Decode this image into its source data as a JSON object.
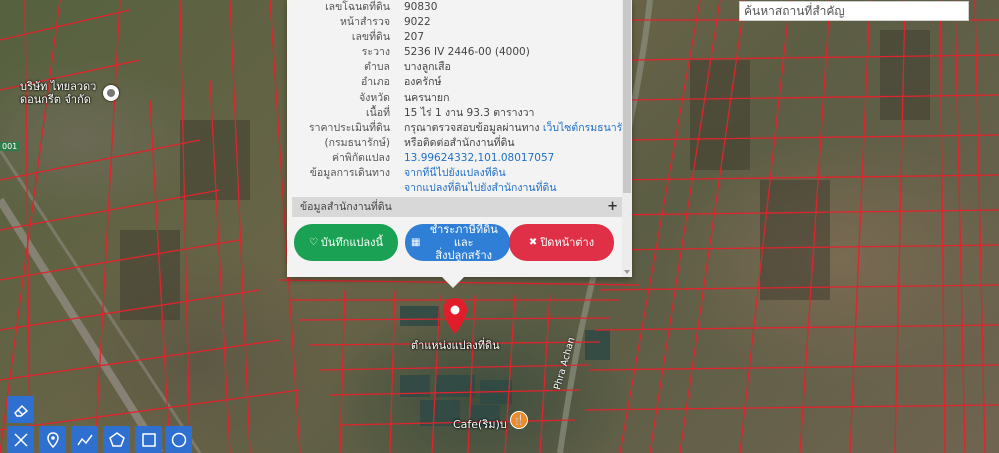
{
  "search": {
    "placeholder": "ค้นหาสถานที่สำคัญ"
  },
  "parcel": {
    "rows": [
      {
        "label": "เลขโฉนดที่ดิน",
        "value": "90830"
      },
      {
        "label": "หน้าสำรวจ",
        "value": "9022"
      },
      {
        "label": "เลขที่ดิน",
        "value": "207"
      },
      {
        "label": "ระวาง",
        "value": "5236 IV 2446-00 (4000)"
      },
      {
        "label": "ตำบล",
        "value": "บางลูกเสือ"
      },
      {
        "label": "อำเภอ",
        "value": "องครักษ์"
      },
      {
        "label": "จังหวัด",
        "value": "นครนายก"
      },
      {
        "label": "เนื้อที่",
        "value": "15 ไร่ 1 งาน 93.3 ตารางวา"
      }
    ],
    "price_label_1": "ราคาประเมินที่ดิน",
    "price_label_2": "(กรมธนารักษ์)",
    "price_text": "กรุณาตรวจสอบข้อมูลผ่านทาง ",
    "price_link": "เว็บไซต์กรมธนารักษ์",
    "price_text_2": "หรือติดต่อสำนักงานที่ดิน",
    "coord_label": "ค่าพิกัดแปลง",
    "coord_value": "13.99624332,101.08017057",
    "travel_label": "ข้อมูลการเดินทาง",
    "travel_link_1": "จากที่นี่ไปยังแปลงที่ดิน",
    "travel_link_2": "จากแปลงที่ดินไปยังสำนักงานที่ดิน"
  },
  "office_section": {
    "label": "ข้อมูลสำนักงานที่ดิน",
    "toggle": "+"
  },
  "buttons": {
    "save": "บันทึกแปลงนี้",
    "pay_1": "ชำระภาษีที่ดินและ",
    "pay_2": "สิ่งปลูกสร้าง",
    "close": "ปิดหน้าต่าง"
  },
  "map": {
    "marker_label": "ตำแหน่งแปลงที่ดิน",
    "company_label_1": "บริษัท ไทยลวดว",
    "company_label_2": "ดอนกรีต จำกัด",
    "cafe_label": "Cafe(ริม)บ",
    "road_label": "Phra Achan",
    "edge_label": "001"
  },
  "tools": [
    "eraser-icon",
    "measure-icon",
    "pin-icon",
    "polyline-icon",
    "polygon-icon",
    "rectangle-icon",
    "circle-icon"
  ],
  "colors": {
    "parcel_line": "#e0242c",
    "accent_blue": "#2e6fd0",
    "save_green": "#1aa153",
    "close_red": "#df3047"
  }
}
